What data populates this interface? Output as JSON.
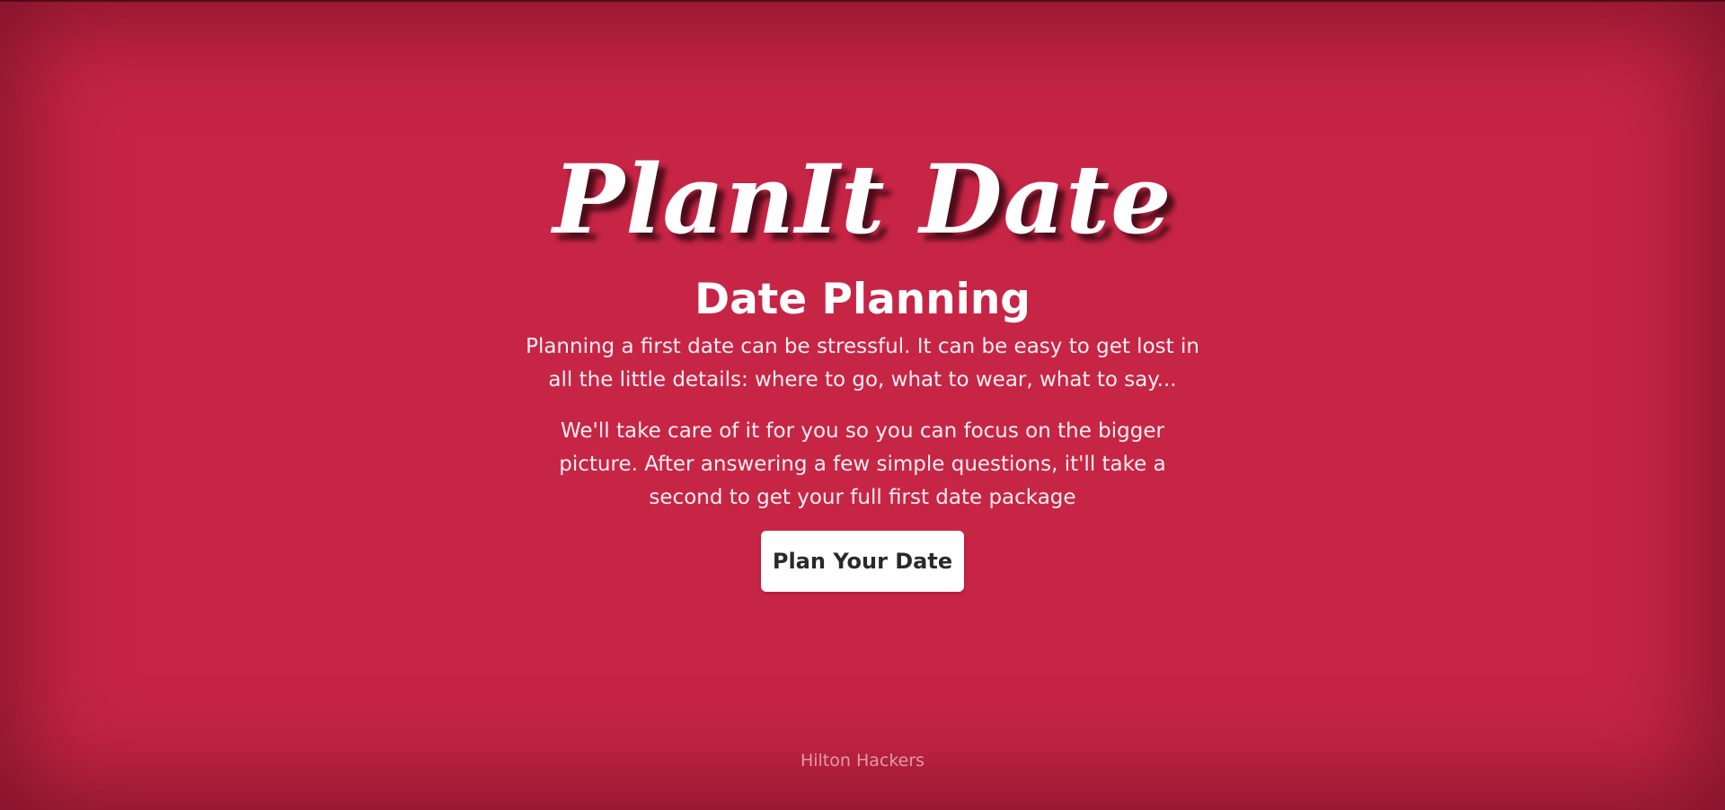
{
  "hero": {
    "logo_text": "PlanIt Date",
    "subtitle": "Date Planning",
    "paragraph_1": "Planning a first date can be stressful. It can be easy to get lost in all the little details: where to go, what to wear, what to say...",
    "paragraph_2": "We'll take care of it for you so you can focus on the bigger picture. After answering a few simple questions, it'll take a second to get your full first date package",
    "cta_label": "Plan Your Date"
  },
  "footer": {
    "credit": "Hilton Hackers"
  },
  "colors": {
    "background": "#c72545",
    "text": "#ffffff",
    "button_bg": "#ffffff",
    "button_text": "#2a2a2a",
    "footer_text": "#e19aa8"
  }
}
